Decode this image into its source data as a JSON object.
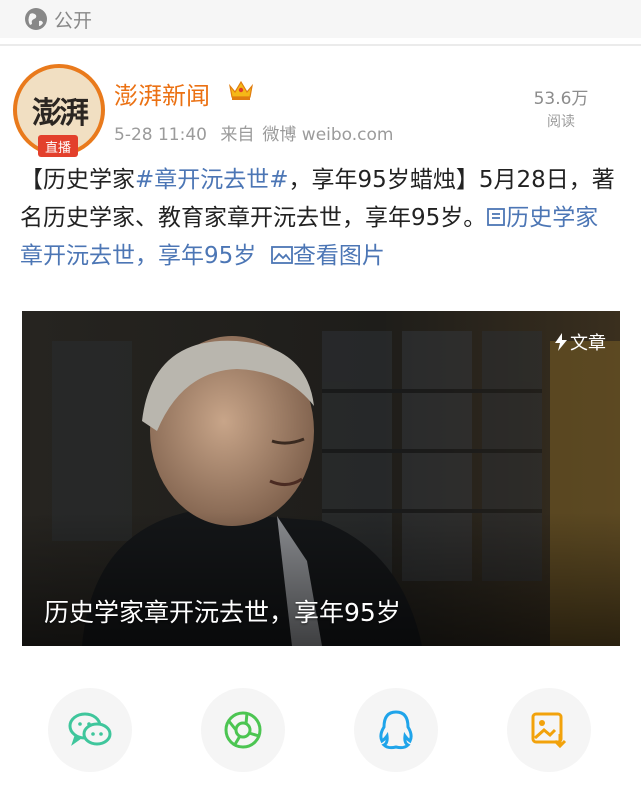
{
  "visibility": {
    "label": "公开",
    "icon": "globe-icon"
  },
  "post": {
    "author": "澎湃新闻",
    "avatar_text": "澎湃",
    "live_badge": "直播",
    "verified_icon": "crown-icon",
    "time": "5-28 11:40",
    "source_prefix": "来自",
    "source_app": "微博 weibo.com",
    "reads_count": "53.6万",
    "reads_label": "阅读",
    "text_bracket_open": "【历史学家",
    "hashtag": "#章开沅去世#",
    "text_bracket_rest": "，享年95岁蜡烛】5月28日，著名历史学家、教育家章开沅去世，享年95岁。",
    "article_link": "历史学家章开沅去世，享年95岁",
    "view_image_link": "查看图片",
    "accent_color": "#eb7113",
    "link_color": "#4c76b5"
  },
  "media": {
    "badge_label": "文章",
    "caption": "历史学家章开沅去世，享年95岁"
  },
  "share": [
    {
      "name": "wechat",
      "icon": "wechat-icon",
      "color": "#3fc69c"
    },
    {
      "name": "moments",
      "icon": "moments-icon",
      "color": "#4cc552"
    },
    {
      "name": "qq",
      "icon": "qq-icon",
      "color": "#1fa4ea"
    },
    {
      "name": "save-image",
      "icon": "save-image-icon",
      "color": "#f2a20b"
    }
  ]
}
